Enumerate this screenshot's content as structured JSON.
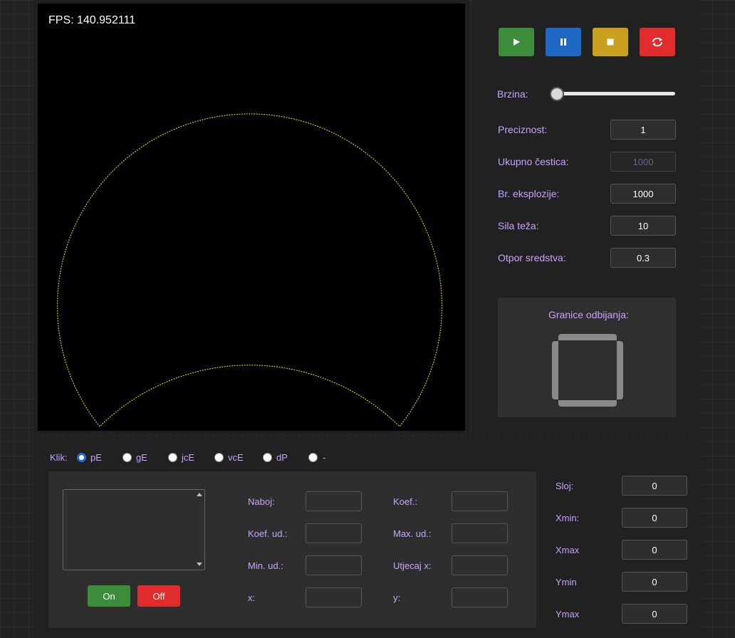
{
  "fps": "FPS: 140.952111",
  "controls": {
    "play": "play-icon",
    "pause": "pause-icon",
    "stop": "stop-icon",
    "reset": "refresh-icon",
    "colors": {
      "play": "#3c8c3c",
      "pause": "#1f67c4",
      "stop": "#c9a11e",
      "reset": "#e02c2c"
    }
  },
  "side": {
    "speed_label": "Brzina:",
    "speed_value": 0,
    "fields": [
      {
        "label": "Preciznost:",
        "value": "1",
        "disabled": false
      },
      {
        "label": "Ukupno čestica:",
        "value": "1000",
        "disabled": true
      },
      {
        "label": "Br. eksplozije:",
        "value": "1000",
        "disabled": false
      },
      {
        "label": "Sila teža:",
        "value": "10",
        "disabled": false
      },
      {
        "label": "Otpor sredstva:",
        "value": "0.3",
        "disabled": false
      }
    ],
    "bounds_title": "Granice odbijanja:"
  },
  "click": {
    "label": "Klik:",
    "options": [
      "pE",
      "gE",
      "jcE",
      "vcE",
      "dP",
      "-"
    ],
    "selected": "pE"
  },
  "params": {
    "left": [
      {
        "label": "Naboj:",
        "value": ""
      },
      {
        "label": "Koef. ud.:",
        "value": ""
      },
      {
        "label": "Min. ud.:",
        "value": ""
      },
      {
        "label": "x:",
        "value": ""
      }
    ],
    "right": [
      {
        "label": "Koef.:",
        "value": ""
      },
      {
        "label": "Max. ud.:",
        "value": ""
      },
      {
        "label": "Utjecaj x:",
        "value": ""
      },
      {
        "label": "y:",
        "value": ""
      }
    ],
    "on_label": "On",
    "off_label": "Off"
  },
  "layer": [
    {
      "label": "Sloj:",
      "value": "0"
    },
    {
      "label": "Xmin:",
      "value": "0"
    },
    {
      "label": "Xmax",
      "value": "0"
    },
    {
      "label": "Ymin",
      "value": "0"
    },
    {
      "label": "Ymax",
      "value": "0"
    }
  ]
}
